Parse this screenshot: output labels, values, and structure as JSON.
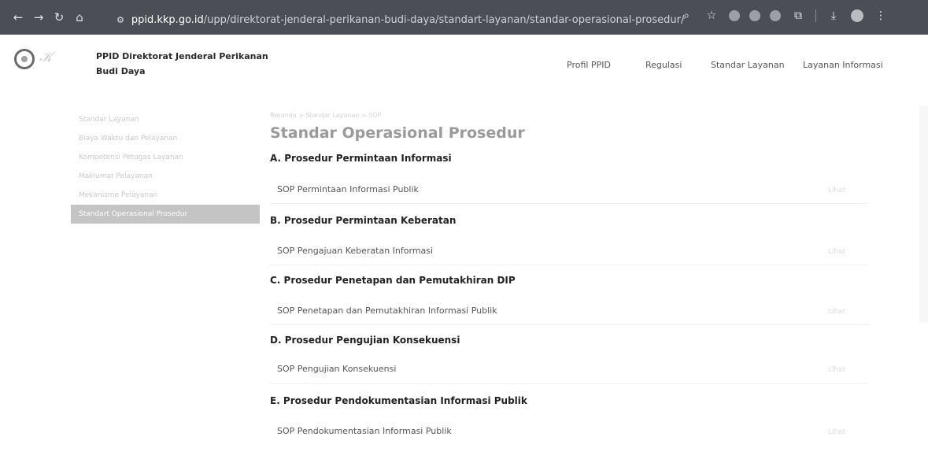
{
  "browser": {
    "url_domain": "ppid.kkp.go.id",
    "url_path": "/upp/direktorat-jenderal-perikanan-budi-daya/standart-layanan/standar-operasional-prosedur/"
  },
  "site": {
    "brand_line1": "PPID Direktorat Jenderal Perikanan",
    "brand_line2": "Budi Daya",
    "nav": [
      "Profil PPID",
      "Regulasi",
      "Standar Layanan",
      "Layanan Informasi"
    ]
  },
  "sidebar": {
    "items": [
      {
        "label": "Standar Layanan"
      },
      {
        "label": "Biaya Waktu dan Pelayanan"
      },
      {
        "label": "Kompetensi Petugas Layanan"
      },
      {
        "label": "Maklumat Pelayanan"
      },
      {
        "label": "Mekanisme Pelayanan"
      },
      {
        "label": "Standart Operasional Prosedur"
      }
    ],
    "active_index": 5
  },
  "main": {
    "breadcrumb": "Beranda > Standar Layanan > SOP",
    "title": "Standar Operasional Prosedur",
    "lihat_label": "Lihat",
    "sections": [
      {
        "title": "A. Prosedur Permintaan Informasi",
        "item": "SOP Permintaan Informasi Publik"
      },
      {
        "title": "B. Prosedur Permintaan Keberatan",
        "item": "SOP Pengajuan Keberatan Informasi"
      },
      {
        "title": "C. Prosedur Penetapan dan Pemutakhiran DIP",
        "item": "SOP Penetapan dan Pemutakhiran Informasi Publik"
      },
      {
        "title": "D. Prosedur Pengujian Konsekuensi",
        "item": "SOP Pengujian Konsekuensi"
      },
      {
        "title": "E. Prosedur Pendokumentasian Informasi Publik",
        "item": "SOP Pendokumentasian Informasi Publik"
      }
    ]
  }
}
